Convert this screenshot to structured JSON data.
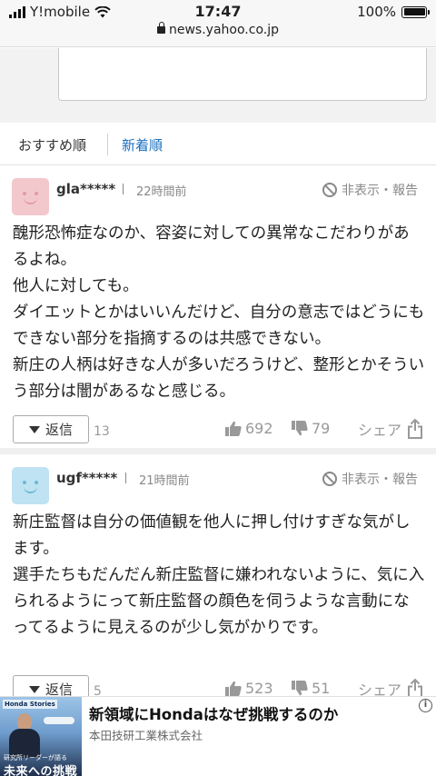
{
  "status_bar": {
    "carrier": "Y!mobile",
    "time": "17:47",
    "battery": "100%",
    "battery_level": 1.0,
    "url": "news.yahoo.co.jp"
  },
  "sort_tabs": {
    "recommended": "おすすめ順",
    "newest": "新着順"
  },
  "comments": [
    {
      "user": "gla*****",
      "time": "22時間前",
      "hide_report": "非表示・報告",
      "avatar_color": "#f3c8cc",
      "avatar_face_color": "#e39aa3",
      "body": "醜形恐怖症なのか、容姿に対しての異常なこだわりがあるよね。\n他人に対しても。\nダイエットとかはいいんだけど、自分の意志ではどうにもできない部分を指摘するのは共感できない。\n新庄の人柄は好きな人が多いだろうけど、整形とかそういう部分は闇があるなと感じる。",
      "reply_label": "返信",
      "reply_count": "13",
      "likes": "692",
      "dislikes": "79",
      "share_label": "シェア"
    },
    {
      "user": "ugf*****",
      "time": "21時間前",
      "hide_report": "非表示・報告",
      "avatar_color": "#bfe3f2",
      "avatar_face_color": "#6cb8d6",
      "body": "新庄監督は自分の価値観を他人に押し付けすぎな気がします。\n選手たちもだんだん新庄監督に嫌われないように、気に入られるようにって新庄監督の顔色を伺うような言動になってるように見えるのが少し気がかりです。",
      "reply_label": "返信",
      "reply_count": "5",
      "likes": "523",
      "dislikes": "51",
      "share_label": "シェア"
    }
  ],
  "ad": {
    "brand": "Honda Stories",
    "caption_small": "研究所リーダーが語る",
    "caption_large": "未来への挑戦",
    "title": "新領域にHondaはなぜ挑戦するのか",
    "sponsor": "本田技研工業株式会社",
    "info_icon": "i"
  }
}
